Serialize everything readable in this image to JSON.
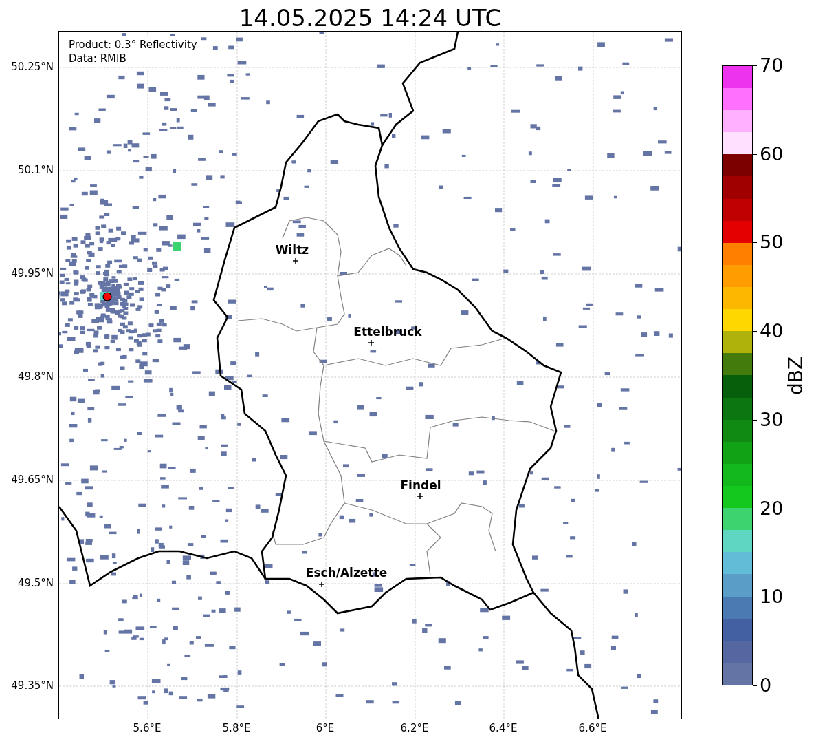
{
  "title": "14.05.2025 14:24 UTC",
  "info_box": {
    "lines": [
      "Product: 0.3° Reflectivity",
      "Data: RMIB"
    ]
  },
  "y_ticks": [
    "50.25°N",
    "50.1°N",
    "49.95°N",
    "49.8°N",
    "49.65°N",
    "49.5°N",
    "49.35°N"
  ],
  "x_ticks": [
    "5.6°E",
    "5.8°E",
    "6°E",
    "6.2°E",
    "6.4°E",
    "6.6°E"
  ],
  "cities": [
    {
      "name": "Wiltz"
    },
    {
      "name": "Ettelbruck"
    },
    {
      "name": "Findel"
    },
    {
      "name": "Esch/Alzette"
    }
  ],
  "colorbar": {
    "label": "dBZ",
    "ticks": [
      "70",
      "60",
      "50",
      "40",
      "30",
      "20",
      "10",
      "0"
    ],
    "segments": [
      {
        "color": "#6475a5"
      },
      {
        "color": "#5567a0"
      },
      {
        "color": "#4360a2"
      },
      {
        "color": "#4a7ab1"
      },
      {
        "color": "#5a9dc6"
      },
      {
        "color": "#62bcd8"
      },
      {
        "color": "#5fd6c2"
      },
      {
        "color": "#3dd36f"
      },
      {
        "color": "#14c81e"
      },
      {
        "color": "#12b81c"
      },
      {
        "color": "#11a215"
      },
      {
        "color": "#108a12"
      },
      {
        "color": "#0c7710"
      },
      {
        "color": "#075f0b"
      },
      {
        "color": "#437c0d"
      },
      {
        "color": "#afb20a"
      },
      {
        "color": "#ffd700"
      },
      {
        "color": "#fcb800"
      },
      {
        "color": "#fe9c00"
      },
      {
        "color": "#ff7f00"
      },
      {
        "color": "#e40000"
      },
      {
        "color": "#c00000"
      },
      {
        "color": "#a00000"
      },
      {
        "color": "#7d0000"
      },
      {
        "color": "#ffe0ff"
      },
      {
        "color": "#ffb0ff"
      },
      {
        "color": "#ff70ff"
      },
      {
        "color": "#ee33ee"
      }
    ]
  }
}
